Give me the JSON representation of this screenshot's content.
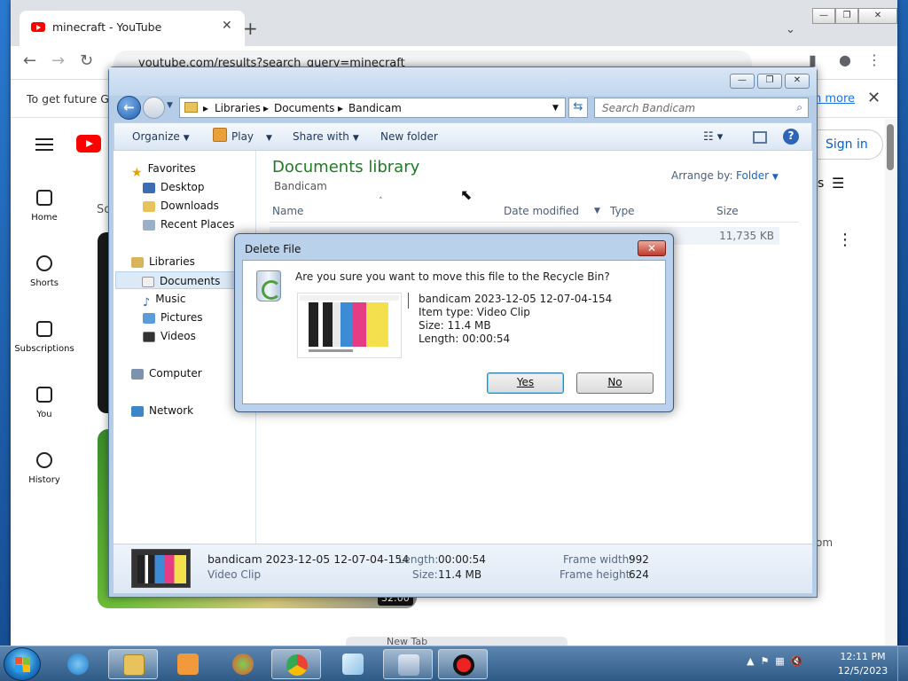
{
  "chrome": {
    "tab_title": "minecraft - YouTube",
    "tab_close": "✕",
    "new_tab": "+",
    "url": "youtube.com/results?search_query=minecraft",
    "infobar_text": "To get future Go",
    "infobar_learn_more": "n more",
    "sign_in": "Sign in",
    "filters_fragment": "s",
    "ghost_tab": "New Tab",
    "win_buttons": [
      "—",
      "❐",
      "✕"
    ]
  },
  "youtube_rail": [
    {
      "label": "Home",
      "icon": "home-icon"
    },
    {
      "label": "Shorts",
      "icon": "shorts-icon"
    },
    {
      "label": "Subscriptions",
      "icon": "subscriptions-icon"
    },
    {
      "label": "You",
      "icon": "you-icon"
    },
    {
      "label": "History",
      "icon": "history-icon"
    }
  ],
  "youtube_misc": {
    "so_fragment": "So",
    "duration": "32:00",
    "com_fragment": "om"
  },
  "explorer": {
    "breadcrumb": [
      "Libraries",
      "Documents",
      "Bandicam"
    ],
    "search_placeholder": "Search Bandicam",
    "commands": {
      "organize": "Organize",
      "play": "Play",
      "share": "Share with",
      "new_folder": "New folder"
    },
    "nav": {
      "favorites": "Favorites",
      "desktop": "Desktop",
      "downloads": "Downloads",
      "recent": "Recent Places",
      "libraries": "Libraries",
      "documents": "Documents",
      "music": "Music",
      "pictures": "Pictures",
      "videos": "Videos",
      "computer": "Computer",
      "network": "Network"
    },
    "library_title": "Documents library",
    "library_sub": "Bandicam",
    "arrange_by": "Arrange by:",
    "arrange_value": "Folder",
    "columns": [
      "Name",
      "Date modified",
      "Type",
      "Size"
    ],
    "row_size": "11,735 KB",
    "details": {
      "file_name": "bandicam 2023-12-05 12-07-04-154",
      "file_type": "Video Clip",
      "length_label": "Length:",
      "length": "00:00:54",
      "size_label": "Size:",
      "size": "11.4 MB",
      "frame_width_label": "Frame width:",
      "frame_width": "992",
      "frame_height_label": "Frame height:",
      "frame_height": "624"
    }
  },
  "dialog": {
    "title": "Delete File",
    "question": "Are you sure you want to move this file to the Recycle Bin?",
    "file_name": "bandicam 2023-12-05 12-07-04-154",
    "item_type": "Item type: Video Clip",
    "size": "Size: 11.4 MB",
    "length": "Length: 00:00:54",
    "yes": "Yes",
    "no": "No"
  },
  "taskbar": {
    "time": "12:11 PM",
    "date": "12/5/2023"
  },
  "colors": {
    "accent_green": "#1e7a23",
    "youtube_red": "#ff0000",
    "link_blue": "#065fd4"
  }
}
